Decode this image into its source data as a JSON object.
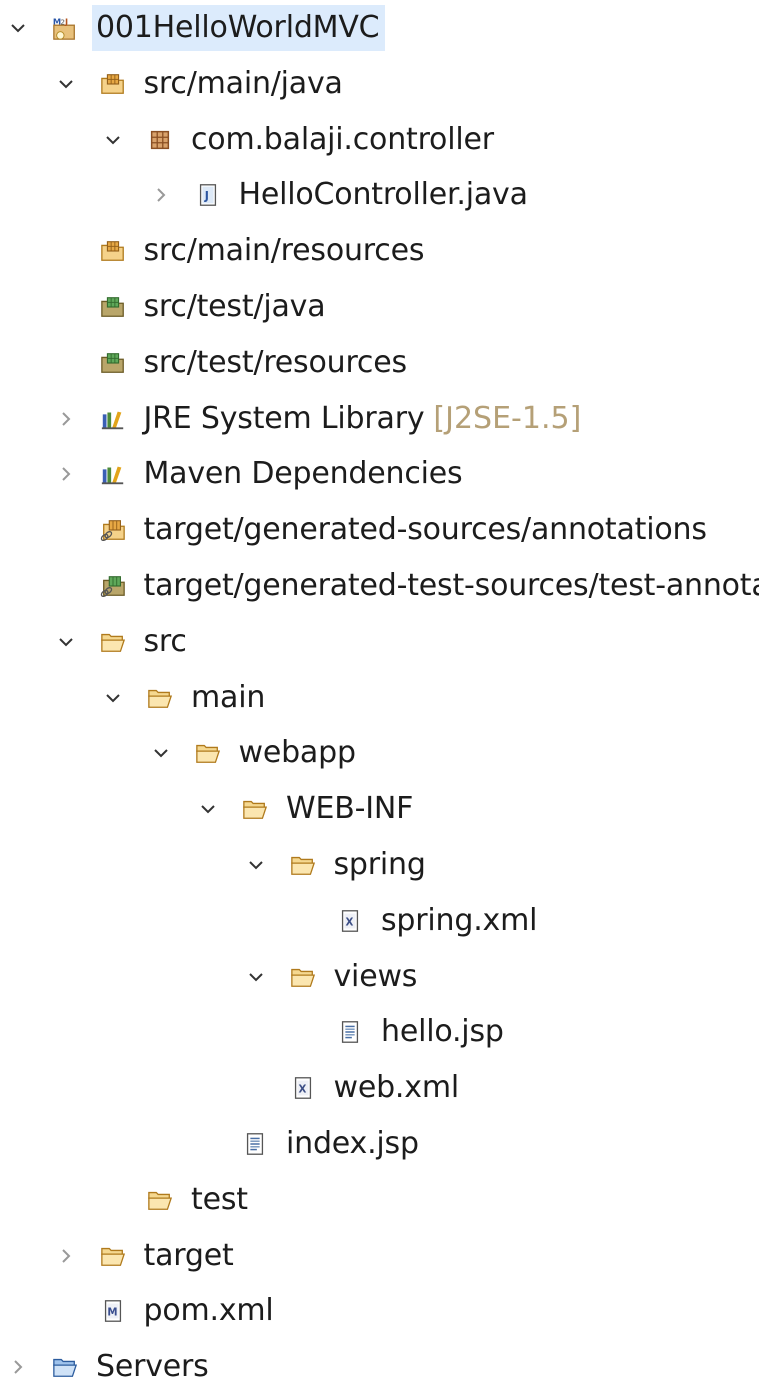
{
  "tree": [
    {
      "label": "001HelloWorldMVC",
      "level": 0,
      "twisty": "expanded",
      "icon": "maven-project-icon",
      "selected": true
    },
    {
      "label": "src/main/java",
      "level": 1,
      "twisty": "expanded",
      "icon": "source-folder-icon"
    },
    {
      "label": "com.balaji.controller",
      "level": 2,
      "twisty": "expanded",
      "icon": "package-icon"
    },
    {
      "label": "HelloController.java",
      "level": 3,
      "twisty": "collapsed",
      "icon": "java-file-icon"
    },
    {
      "label": "src/main/resources",
      "level": 1,
      "twisty": "none",
      "icon": "source-folder-icon"
    },
    {
      "label": "src/test/java",
      "level": 1,
      "twisty": "none",
      "icon": "test-source-folder-icon"
    },
    {
      "label": "src/test/resources",
      "level": 1,
      "twisty": "none",
      "icon": "test-source-folder-icon"
    },
    {
      "label": "JRE System Library",
      "decor": "[J2SE-1.5]",
      "level": 1,
      "twisty": "collapsed",
      "icon": "library-icon"
    },
    {
      "label": "Maven Dependencies",
      "level": 1,
      "twisty": "collapsed",
      "icon": "library-icon"
    },
    {
      "label": "target/generated-sources/annotations",
      "level": 1,
      "twisty": "none",
      "icon": "linked-source-folder-icon"
    },
    {
      "label": "target/generated-test-sources/test-annotations",
      "level": 1,
      "twisty": "none",
      "icon": "linked-test-source-folder-icon"
    },
    {
      "label": "src",
      "level": 1,
      "twisty": "expanded",
      "icon": "folder-icon"
    },
    {
      "label": "main",
      "level": 2,
      "twisty": "expanded",
      "icon": "folder-icon"
    },
    {
      "label": "webapp",
      "level": 3,
      "twisty": "expanded",
      "icon": "folder-icon"
    },
    {
      "label": "WEB-INF",
      "level": 4,
      "twisty": "expanded",
      "icon": "folder-icon"
    },
    {
      "label": "spring",
      "level": 5,
      "twisty": "expanded",
      "icon": "folder-icon"
    },
    {
      "label": "spring.xml",
      "level": 6,
      "twisty": "none",
      "icon": "xml-file-icon"
    },
    {
      "label": "views",
      "level": 5,
      "twisty": "expanded",
      "icon": "folder-icon"
    },
    {
      "label": "hello.jsp",
      "level": 6,
      "twisty": "none",
      "icon": "jsp-file-icon"
    },
    {
      "label": "web.xml",
      "level": 5,
      "twisty": "none",
      "icon": "xml-file-icon"
    },
    {
      "label": "index.jsp",
      "level": 4,
      "twisty": "none",
      "icon": "jsp-file-icon"
    },
    {
      "label": "test",
      "level": 2,
      "twisty": "none",
      "icon": "folder-icon"
    },
    {
      "label": "target",
      "level": 1,
      "twisty": "collapsed",
      "icon": "folder-icon"
    },
    {
      "label": "pom.xml",
      "level": 1,
      "twisty": "none",
      "icon": "maven-pom-icon"
    },
    {
      "label": "Servers",
      "level": 0,
      "twisty": "collapsed",
      "icon": "server-folder-icon"
    }
  ]
}
